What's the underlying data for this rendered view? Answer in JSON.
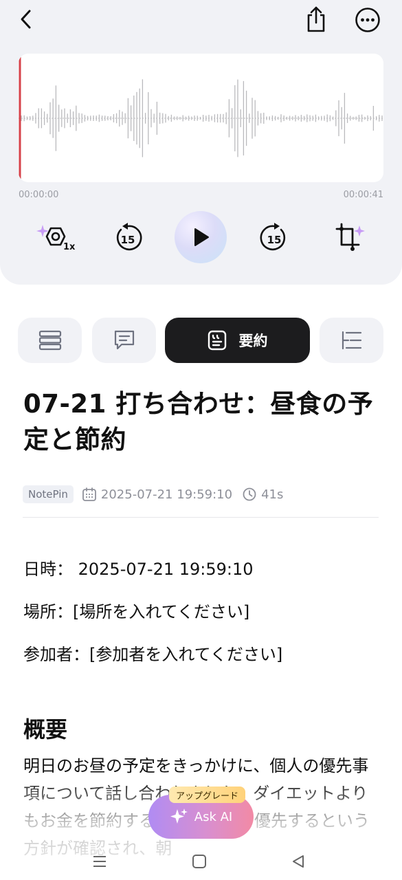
{
  "player": {
    "time_start": "00:00:00",
    "time_end": "00:00:41",
    "progress": 0,
    "rewind_seconds": "15",
    "forward_seconds": "15",
    "speed_label": "1x",
    "accent_color": "#d6424a"
  },
  "tabs": {
    "active": "summary",
    "summary_label": "要約"
  },
  "doc": {
    "title": "07-21 打ち合わせ：昼食の予定と節約",
    "source": "NotePin",
    "datetime": "2025-07-21 19:59:10",
    "duration": "41s",
    "fields": {
      "date": "日時： 2025-07-21 19:59:10",
      "place": "場所：[場所を入れてください]",
      "people": "参加者：[参加者を入れてください]"
    },
    "overview_title": "概要",
    "overview_text": "明日のお昼の予定をきっかけに、個人の優先事項について話し合われました。ダイエットよりもお金を節約するための節約を優先するという方針が確認され、朝"
  },
  "ask_ai": {
    "label": "Ask AI",
    "badge": "アップグレード"
  },
  "icons": {
    "back": "back-arrow-icon",
    "share": "share-icon",
    "more": "more-icon"
  }
}
